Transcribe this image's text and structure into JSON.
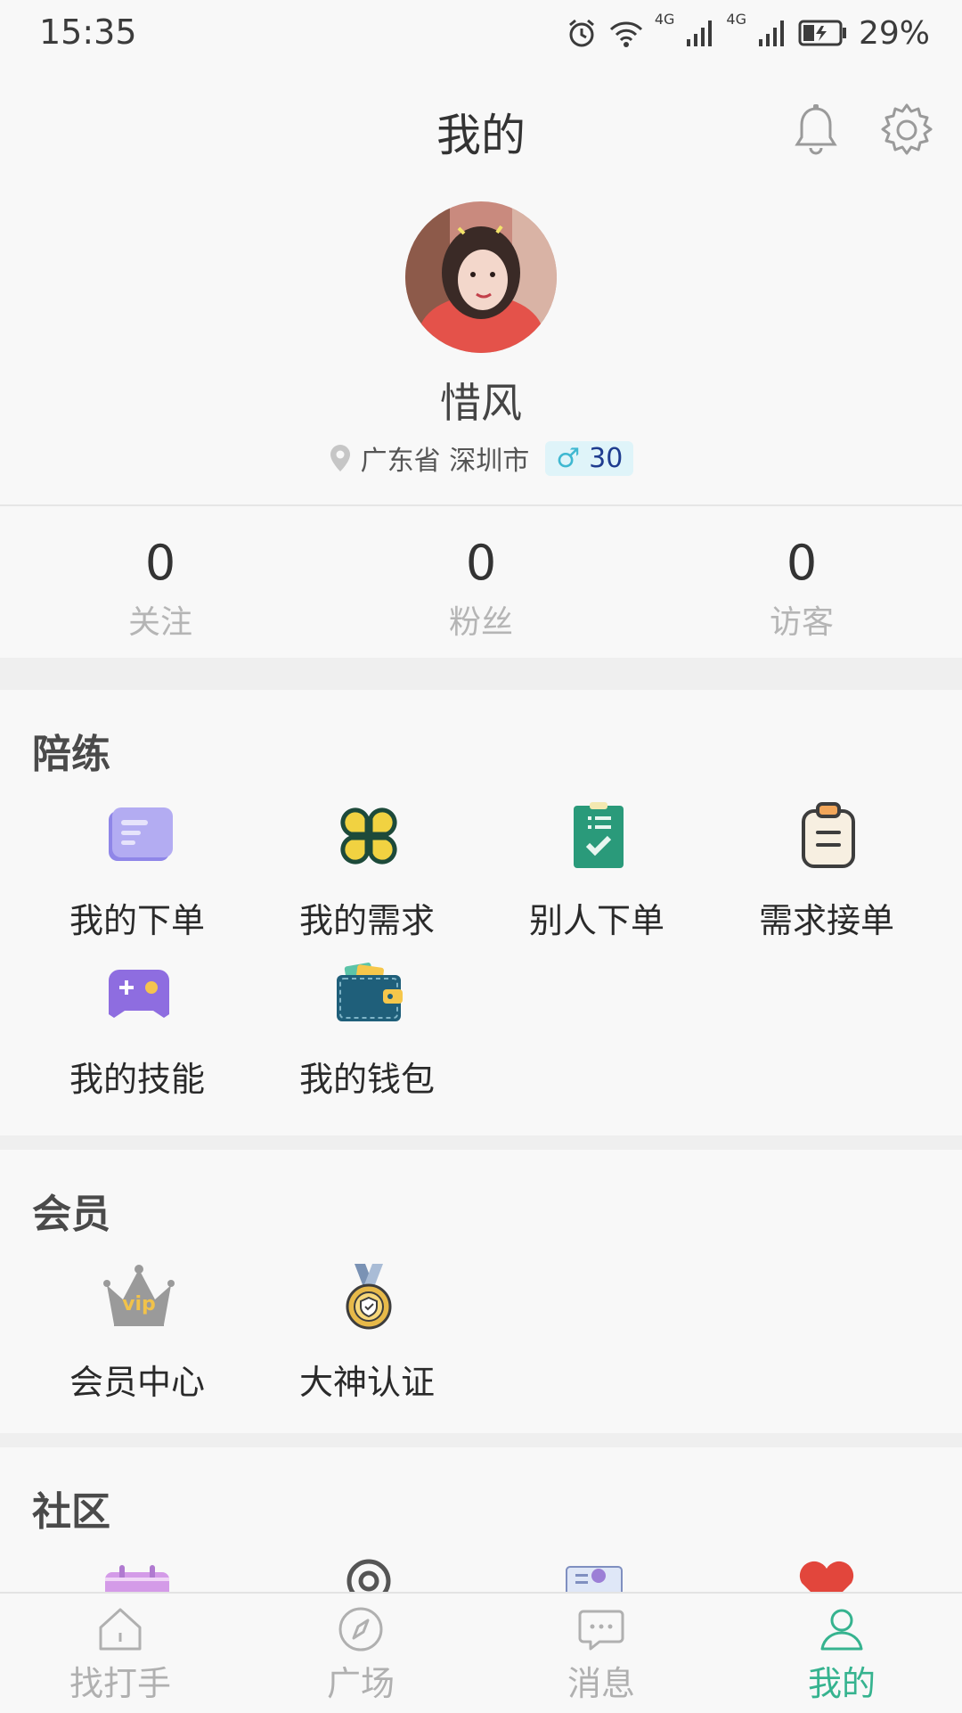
{
  "status_bar": {
    "time": "15:35",
    "network_1": "4G",
    "network_2": "4G",
    "battery": "29%"
  },
  "nav": {
    "title": "我的"
  },
  "profile": {
    "nickname": "惜风",
    "location": "广东省 深圳市",
    "gender_symbol": "♂",
    "age": "30"
  },
  "stats": [
    {
      "value": "0",
      "label": "关注"
    },
    {
      "value": "0",
      "label": "粉丝"
    },
    {
      "value": "0",
      "label": "访客"
    }
  ],
  "sections": {
    "companion": {
      "title": "陪练",
      "items": [
        {
          "label": "我的下单",
          "icon": "order-card-icon"
        },
        {
          "label": "我的需求",
          "icon": "clover-icon"
        },
        {
          "label": "别人下单",
          "icon": "checklist-icon"
        },
        {
          "label": "需求接单",
          "icon": "clipboard-icon"
        },
        {
          "label": "我的技能",
          "icon": "gamepad-icon"
        },
        {
          "label": "我的钱包",
          "icon": "wallet-icon"
        }
      ]
    },
    "member": {
      "title": "会员",
      "items": [
        {
          "label": "会员中心",
          "icon": "vip-crown-icon"
        },
        {
          "label": "大神认证",
          "icon": "medal-icon"
        }
      ]
    },
    "community": {
      "title": "社区"
    }
  },
  "tabbar": [
    {
      "label": "找打手",
      "icon": "home-icon",
      "active": false
    },
    {
      "label": "广场",
      "icon": "compass-icon",
      "active": false
    },
    {
      "label": "消息",
      "icon": "message-icon",
      "active": false
    },
    {
      "label": "我的",
      "icon": "user-icon",
      "active": true
    }
  ],
  "colors": {
    "accent": "#36b38f",
    "badge_bg": "#dff4f9",
    "secondary_text": "#b5b5b5"
  }
}
